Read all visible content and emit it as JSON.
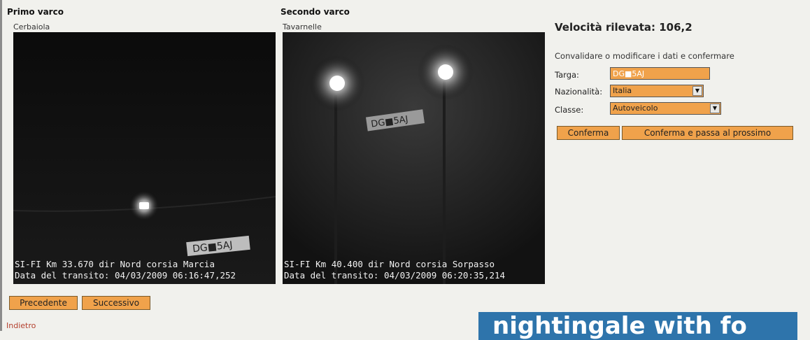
{
  "first_gate": {
    "title": "Primo varco",
    "location": "Cerbaiola",
    "caption_line1": "SI-FI Km 33.670 dir Nord corsia Marcia",
    "caption_line2": "Data del transito: 04/03/2009 06:16:47,252",
    "plate_text": "DG■5AJ"
  },
  "second_gate": {
    "title": "Secondo varco",
    "location": "Tavarnelle",
    "caption_line1": "SI-FI Km 40.400 dir Nord corsia Sorpasso",
    "caption_line2": "Data del transito: 04/03/2009 06:20:35,214",
    "plate_text": "DG■5AJ"
  },
  "speed": {
    "label": "Velocità rilevata: 106,2"
  },
  "form": {
    "instructions": "Convalidare o modificare i dati e confermare",
    "plate_label": "Targa:",
    "plate_value": "DG■5AJ",
    "nationality_label": "Nazionalità:",
    "nationality_value": "Italia",
    "class_label": "Classe:",
    "class_value": "Autoveicolo",
    "confirm_label": "Conferma",
    "confirm_next_label": "Conferma e passa al prossimo"
  },
  "navigation": {
    "previous_label": "Precedente",
    "next_label": "Successivo",
    "back_label": "Indietro"
  },
  "banner": {
    "text": "nightingale with fo"
  },
  "colors": {
    "accent": "#f0a24b",
    "background": "#f1f1ed",
    "link": "#b4402e",
    "banner": "#2e74ab"
  }
}
